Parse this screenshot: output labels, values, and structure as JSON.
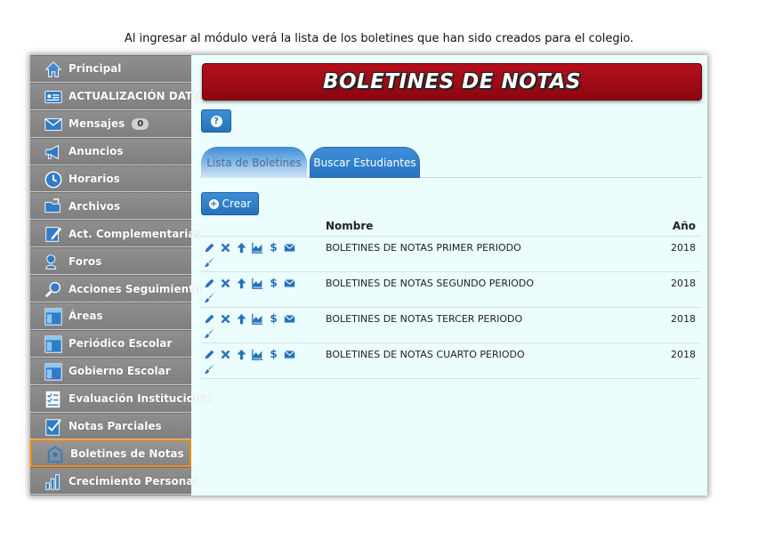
{
  "caption": "Al ingresar al módulo verá la lista de los boletines que han sido creados para el colegio.",
  "sidebar": {
    "items": [
      {
        "label": "Principal",
        "icon": "home-icon"
      },
      {
        "label": "ACTUALIZACIÓN DATOS",
        "icon": "id-card-icon"
      },
      {
        "label": "Mensajes",
        "icon": "envelope-icon",
        "badge": "0"
      },
      {
        "label": "Anuncios",
        "icon": "megaphone-icon"
      },
      {
        "label": "Horarios",
        "icon": "clock-icon"
      },
      {
        "label": "Archivos",
        "icon": "folder-icon"
      },
      {
        "label": "Act. Complementarias",
        "icon": "edit-icon"
      },
      {
        "label": "Foros",
        "icon": "forum-icon"
      },
      {
        "label": "Acciones Seguimiento",
        "icon": "magnifier-icon"
      },
      {
        "label": "Áreas",
        "icon": "window-icon"
      },
      {
        "label": "Periódico Escolar",
        "icon": "window-icon"
      },
      {
        "label": "Gobierno Escolar",
        "icon": "window-icon"
      },
      {
        "label": "Evaluación Institucional",
        "icon": "checklist-icon"
      },
      {
        "label": "Notas Parciales",
        "icon": "notes-icon"
      },
      {
        "label": "Boletines de Notas",
        "icon": "report-icon",
        "active": true
      },
      {
        "label": "Crecimiento Personal",
        "icon": "growth-icon"
      }
    ]
  },
  "header": {
    "title": "BOLETINES DE NOTAS"
  },
  "toolbar": {
    "help_label": "?",
    "crear_label": "Crear"
  },
  "tabs": [
    {
      "label": "Lista de Boletines"
    },
    {
      "label": "Buscar Estudiantes"
    }
  ],
  "table": {
    "columns": [
      "Nombre",
      "Año"
    ],
    "rows": [
      {
        "name": "BOLETINES DE NOTAS PRIMER PERIODO",
        "year": "2018"
      },
      {
        "name": "BOLETINES DE NOTAS SEGUNDO PERIODO",
        "year": "2018"
      },
      {
        "name": "BOLETINES DE NOTAS TERCER PERIODO",
        "year": "2018"
      },
      {
        "name": "BOLETINES DE NOTAS CUARTO PERIODO",
        "year": "2018"
      }
    ],
    "row_actions": [
      "pencil-icon",
      "close-icon",
      "arrow-up-icon",
      "chart-icon",
      "dollar-icon",
      "envelope-icon",
      "brush-icon"
    ],
    "dollar_glyph": "$"
  },
  "colors": {
    "accent_blue": "#2672bc",
    "banner_red": "#a00c16",
    "sidebar_gray": "#8a8a8a",
    "active_border": "#f08a12",
    "content_bg": "#ecfdfd"
  }
}
